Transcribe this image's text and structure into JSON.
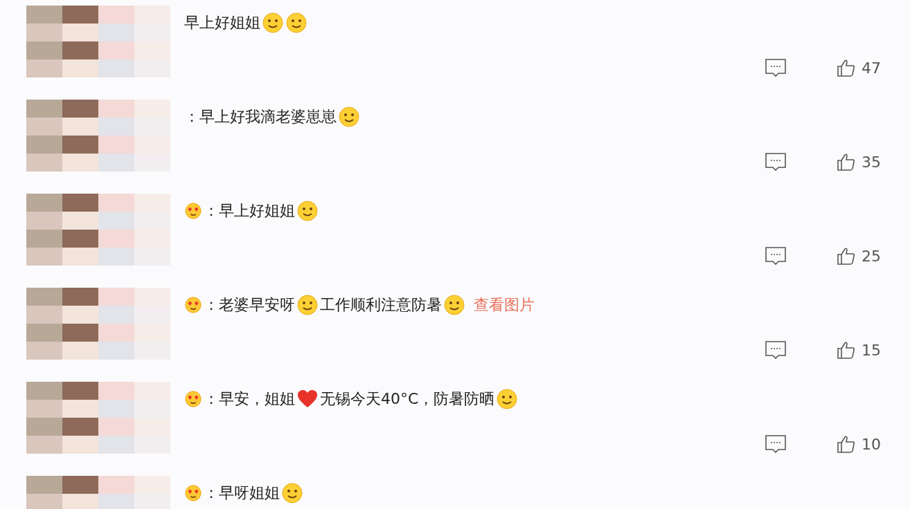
{
  "comments": [
    {
      "parts": [
        {
          "kind": "text",
          "text": "早上好姐姐"
        },
        {
          "kind": "face"
        },
        {
          "kind": "face"
        }
      ],
      "likes": "47"
    },
    {
      "parts": [
        {
          "kind": "text",
          "text": "：早上好我滴老婆崽崽"
        },
        {
          "kind": "face"
        }
      ],
      "likes": "35"
    },
    {
      "parts": [
        {
          "kind": "badge"
        },
        {
          "kind": "text",
          "text": "：早上好姐姐"
        },
        {
          "kind": "face"
        }
      ],
      "likes": "25"
    },
    {
      "parts": [
        {
          "kind": "badge"
        },
        {
          "kind": "text",
          "text": "：老婆早安呀"
        },
        {
          "kind": "face"
        },
        {
          "kind": "text",
          "text": "工作顺利注意防暑"
        },
        {
          "kind": "face"
        },
        {
          "kind": "link",
          "text": "查看图片"
        }
      ],
      "likes": "15"
    },
    {
      "parts": [
        {
          "kind": "badge"
        },
        {
          "kind": "text",
          "text": "：早安，姐姐"
        },
        {
          "kind": "heart"
        },
        {
          "kind": "text",
          "text": "无锡今天40°C，防暑防晒"
        },
        {
          "kind": "face"
        }
      ],
      "likes": "10"
    },
    {
      "parts": [
        {
          "kind": "badge"
        },
        {
          "kind": "text",
          "text": "：早呀姐姐"
        },
        {
          "kind": "face"
        }
      ]
    }
  ]
}
